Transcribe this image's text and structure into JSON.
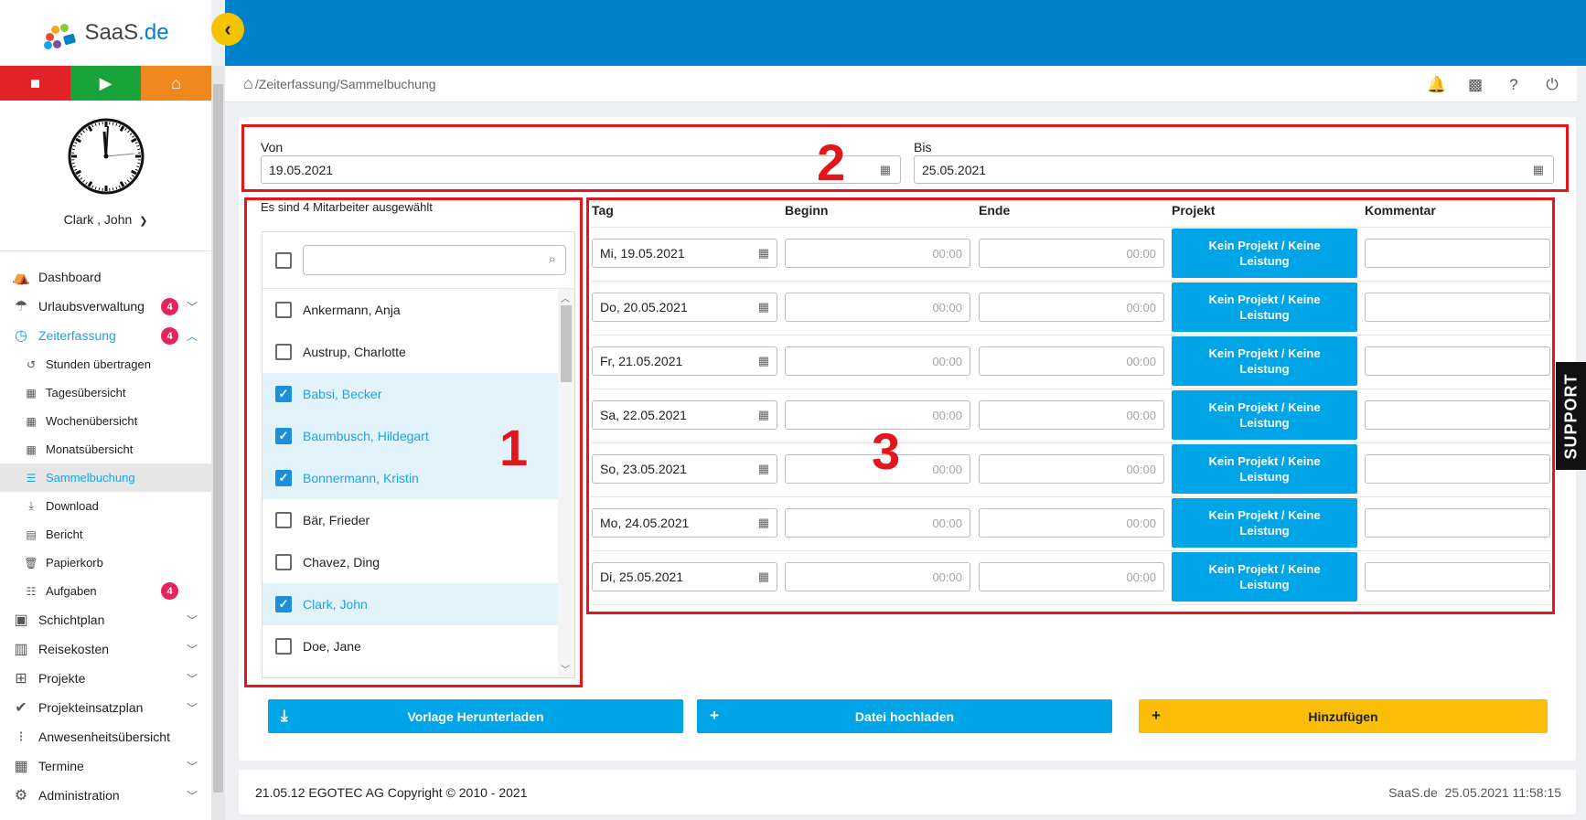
{
  "brand": {
    "logo_text": "SaaS",
    "logo_suffix": ".de"
  },
  "sidebar": {
    "user_name": "Clark , John",
    "nav": [
      {
        "label": "Dashboard"
      },
      {
        "label": "Urlaubsverwaltung",
        "badge": "4"
      },
      {
        "label": "Zeiterfassung",
        "badge": "4"
      },
      {
        "label": "Stunden übertragen"
      },
      {
        "label": "Tagesübersicht"
      },
      {
        "label": "Wochenübersicht"
      },
      {
        "label": "Monatsübersicht"
      },
      {
        "label": "Sammelbuchung"
      },
      {
        "label": "Download"
      },
      {
        "label": "Bericht"
      },
      {
        "label": "Papierkorb"
      },
      {
        "label": "Aufgaben",
        "badge": "4"
      },
      {
        "label": "Schichtplan"
      },
      {
        "label": "Reisekosten"
      },
      {
        "label": "Projekte"
      },
      {
        "label": "Projekteinsatzplan"
      },
      {
        "label": "Anwesenheitsübersicht"
      },
      {
        "label": "Termine"
      },
      {
        "label": "Administration"
      }
    ]
  },
  "breadcrumb": "/Zeiterfassung/Sammelbuchung",
  "range": {
    "von_label": "Von",
    "von_value": "19.05.2021",
    "bis_label": "Bis",
    "bis_value": "25.05.2021"
  },
  "annotations": {
    "box1": "1",
    "box2": "2",
    "box3": "3"
  },
  "employees": {
    "caption": "Es sind 4 Mitarbeiter ausgewählt",
    "list": [
      {
        "name": "Ankermann, Anja",
        "selected": false
      },
      {
        "name": "Austrup, Charlotte",
        "selected": false
      },
      {
        "name": "Babsi, Becker",
        "selected": true
      },
      {
        "name": "Baumbusch, Hildegart",
        "selected": true
      },
      {
        "name": "Bonnermann, Kristin",
        "selected": true
      },
      {
        "name": "Bär, Frieder",
        "selected": false
      },
      {
        "name": "Chavez, Ding",
        "selected": false
      },
      {
        "name": "Clark, John",
        "selected": true
      },
      {
        "name": "Doe, Jane",
        "selected": false
      }
    ]
  },
  "table": {
    "headers": {
      "tag": "Tag",
      "beginn": "Beginn",
      "ende": "Ende",
      "projekt": "Projekt",
      "kommentar": "Kommentar"
    },
    "rows": [
      {
        "day": "Mi, 19.05.2021",
        "begin": "00:00",
        "end": "00:00",
        "project": "Kein Projekt / Keine Leistung"
      },
      {
        "day": "Do, 20.05.2021",
        "begin": "00:00",
        "end": "00:00",
        "project": "Kein Projekt / Keine Leistung"
      },
      {
        "day": "Fr, 21.05.2021",
        "begin": "00:00",
        "end": "00:00",
        "project": "Kein Projekt / Keine Leistung"
      },
      {
        "day": "Sa, 22.05.2021",
        "begin": "00:00",
        "end": "00:00",
        "project": "Kein Projekt / Keine Leistung"
      },
      {
        "day": "So, 23.05.2021",
        "begin": "00:00",
        "end": "00:00",
        "project": "Kein Projekt / Keine Leistung"
      },
      {
        "day": "Mo, 24.05.2021",
        "begin": "00:00",
        "end": "00:00",
        "project": "Kein Projekt / Keine Leistung"
      },
      {
        "day": "Di, 25.05.2021",
        "begin": "00:00",
        "end": "00:00",
        "project": "Kein Projekt / Keine Leistung"
      }
    ]
  },
  "actions": {
    "download_label": "Vorlage Herunterladen",
    "upload_label": "Datei hochladen",
    "add_label": "Hinzufügen"
  },
  "footer": {
    "copyright": "21.05.12 EGOTEC AG Copyright © 2010 - 2021",
    "right": "SaaS.de  25.05.2021 11:58:15"
  },
  "support_label": "SUPPORT",
  "colors": {
    "primary": "#0081c9",
    "accent": "#00a5e8",
    "annotation": "#e3161b",
    "badge": "#e6245c",
    "add_button": "#fbbd08"
  }
}
